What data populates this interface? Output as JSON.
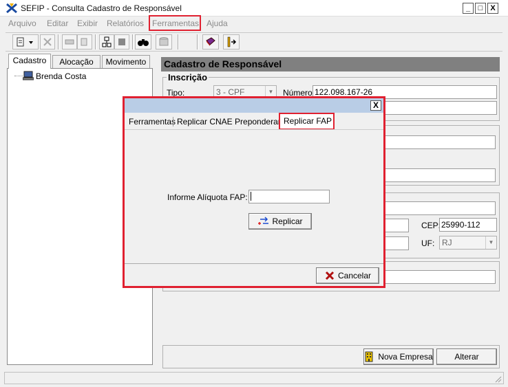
{
  "window": {
    "title": "SEFIP - Consulta Cadastro de Responsável",
    "minimize": "_",
    "maximize": "□",
    "close": "X"
  },
  "menu": [
    "Arquivo",
    "Editar",
    "Exibir",
    "Relatórios",
    "Ferramentas",
    "Ajuda"
  ],
  "left_tabs": [
    "Cadastro",
    "Alocação",
    "Movimento"
  ],
  "tree": {
    "item": "Brenda Costa"
  },
  "panel": {
    "header": "Cadastro de Responsável",
    "inscricao_label": "Inscrição",
    "tipo_label": "Tipo:",
    "tipo_value": "3 - CPF",
    "numero_label": "Número:",
    "numero_value": "122.098.167-26",
    "cep_label": "CEP:",
    "cep_value": "25990-112",
    "uf_label": "UF:",
    "uf_value": "RJ",
    "nova_empresa": "Nova Empresa",
    "alterar": "Alterar"
  },
  "dialog": {
    "close": "X",
    "tabs": [
      "Ferramentas",
      "Replicar CNAE Preponderante",
      "Replicar FAP"
    ],
    "aliquota_label": "Informe Alíquota FAP:",
    "aliquota_value": "",
    "replicar": "Replicar",
    "cancelar": "Cancelar"
  },
  "colors": {
    "highlight": "#e02030",
    "dialog_title": "#b9cde6",
    "header_bg": "#808080"
  }
}
